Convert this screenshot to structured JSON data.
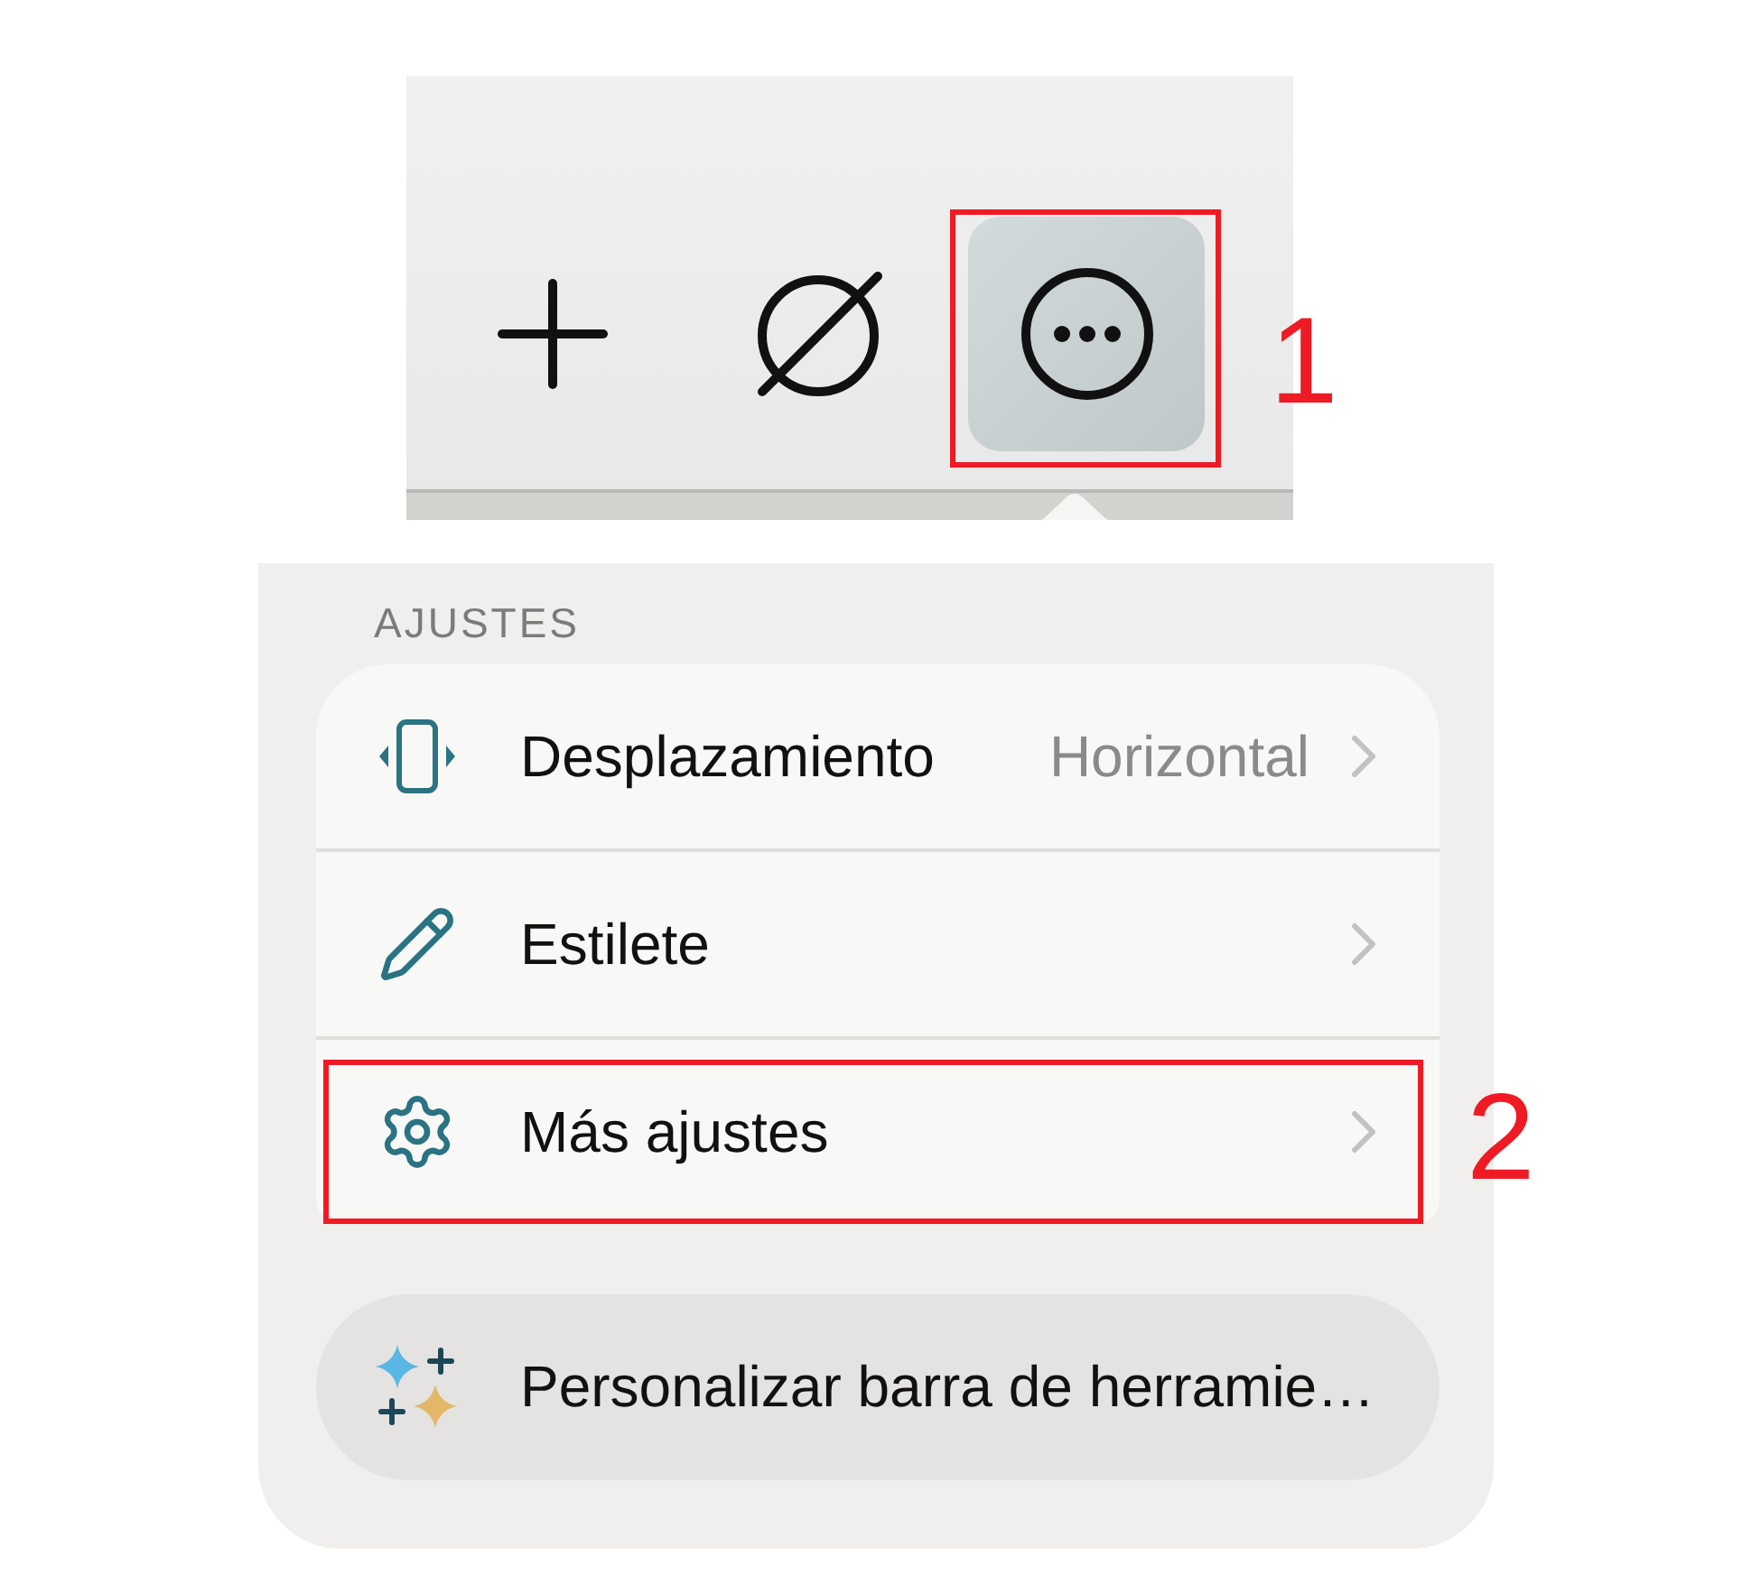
{
  "toolbar": {
    "buttons": [
      {
        "selected": false
      },
      {
        "selected": false
      },
      {
        "selected": true,
        "callout": "1"
      }
    ]
  },
  "menu": {
    "section_title": "AJUSTES",
    "items": [
      {
        "label": "Desplazamiento",
        "value": "Horizontal"
      },
      {
        "label": "Estilete"
      },
      {
        "label": "Más ajustes",
        "callout": "2"
      }
    ],
    "action": {
      "label": "Personalizar barra de herramie…"
    }
  }
}
